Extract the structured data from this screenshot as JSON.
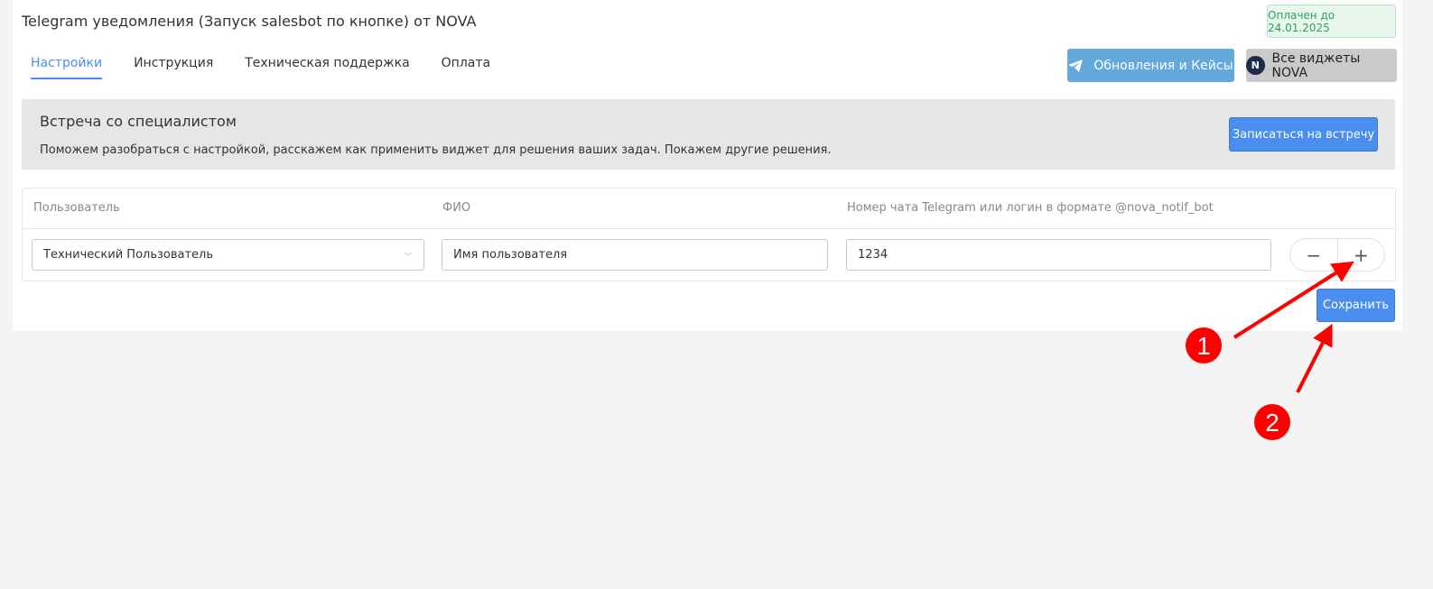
{
  "header": {
    "title": "Telegram уведомления (Запуск salesbot по кнопке) от NOVA",
    "paid_badge": "Оплачен до 24.01.2025"
  },
  "tabs": [
    {
      "label": "Настройки",
      "active": true
    },
    {
      "label": "Инструкция"
    },
    {
      "label": "Техническая поддержка"
    },
    {
      "label": "Оплата"
    }
  ],
  "buttons": {
    "updates": "Обновления и Кейсы",
    "all_widgets": "Все виджеты NOVA",
    "nova_logo": "N",
    "save": "Сохранить"
  },
  "meeting": {
    "title": "Встреча со специалистом",
    "text": "Поможем разобраться с настройкой, расскажем как применить виджет для решения ваших задач. Покажем другие решения.",
    "button": "Записаться на встречу"
  },
  "table": {
    "headers": [
      "Пользователь",
      "ФИО",
      "Номер чата Telegram или логин в формате @nova_notif_bot"
    ],
    "row": {
      "user": "Технический Пользователь",
      "name": "Имя пользователя",
      "chat": "1234"
    }
  },
  "stepper": {
    "minus": "−",
    "plus": "+"
  },
  "annotations": {
    "first": "1",
    "second": "2",
    "color": "#ff0000"
  }
}
